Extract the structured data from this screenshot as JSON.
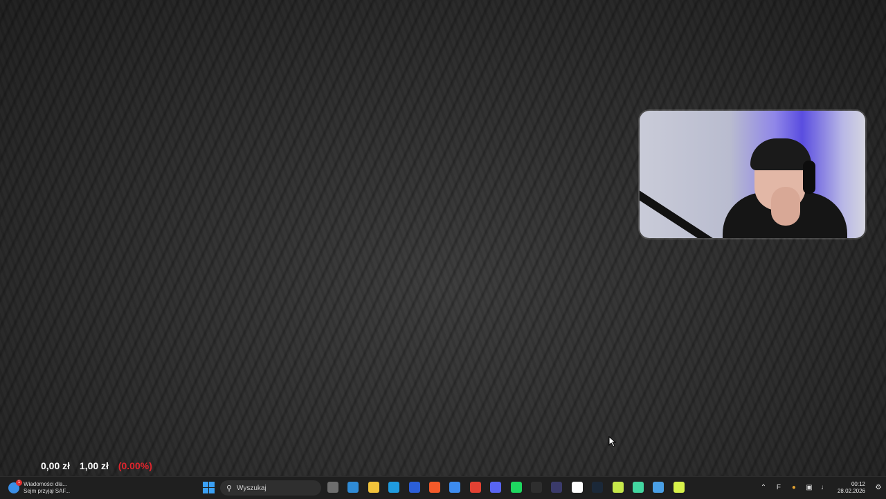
{
  "ticker": {
    "value1": "0,00 zł",
    "value2": "1,00 zł",
    "change": "(0.00%)"
  },
  "news": {
    "title": "Wiadomości dla...",
    "subtitle": "Sejm przyjął SAF...",
    "badge": "1"
  },
  "search": {
    "placeholder": "Wyszukaj"
  },
  "taskbar_apps": [
    {
      "name": "task-view",
      "color": "#6e6e6e"
    },
    {
      "name": "widgets",
      "color": "#2f8bd6"
    },
    {
      "name": "file-explorer",
      "color": "#f2c33b"
    },
    {
      "name": "edge",
      "color": "#1f9be0"
    },
    {
      "name": "microsoft-store",
      "color": "#2b5fd9"
    },
    {
      "name": "brave",
      "color": "#f45a2a"
    },
    {
      "name": "messenger",
      "color": "#3d8cf0"
    },
    {
      "name": "chrome",
      "color": "#e34133"
    },
    {
      "name": "discord",
      "color": "#5865f2"
    },
    {
      "name": "spotify",
      "color": "#1ed760"
    },
    {
      "name": "terminal",
      "color": "#2e2e2e"
    },
    {
      "name": "app-unknown",
      "color": "#3a3a6a"
    },
    {
      "name": "app-unknown-2",
      "color": "#ffffff"
    },
    {
      "name": "steam",
      "color": "#1b2838"
    },
    {
      "name": "live-app",
      "color": "#c6e84a"
    },
    {
      "name": "app-green",
      "color": "#43d6a0"
    },
    {
      "name": "app-paint",
      "color": "#4aa0e6"
    },
    {
      "name": "live-app-2",
      "color": "#d8f24a"
    }
  ],
  "tray": {
    "time": "00:12",
    "date": "28.02.2026"
  }
}
